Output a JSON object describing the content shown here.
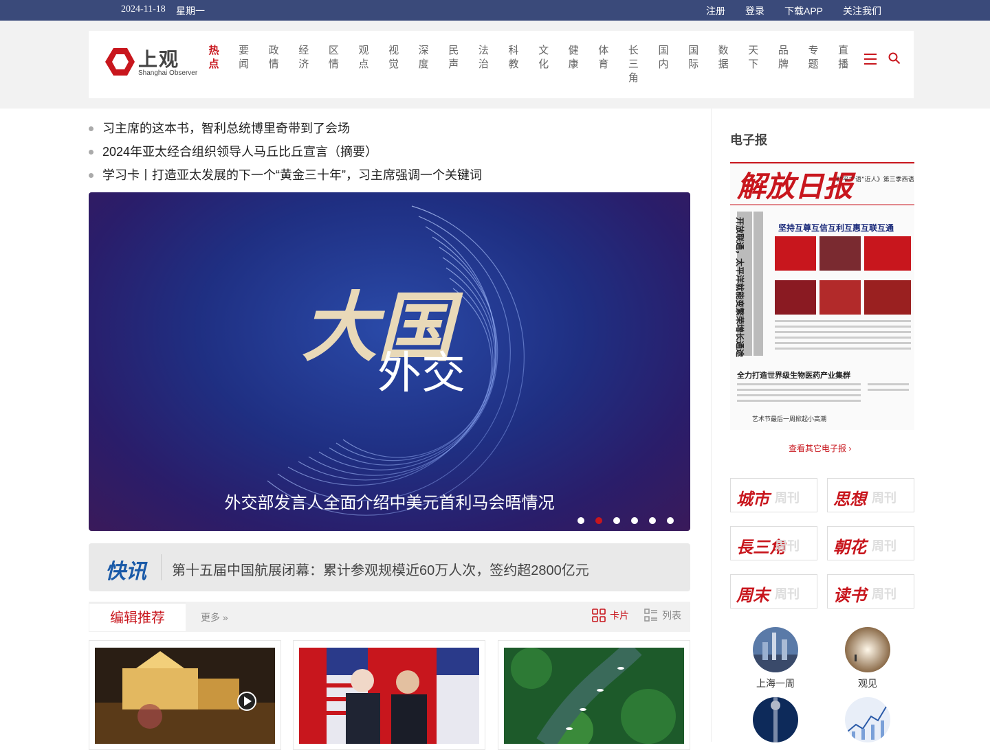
{
  "topbar": {
    "date": "2024-11-18",
    "weekday": "星期一",
    "links": [
      "注册",
      "登录",
      "下载APP",
      "关注我们"
    ]
  },
  "logo": {
    "cn": "上观",
    "en": "Shanghai Observer"
  },
  "nav": [
    "热点",
    "要闻",
    "政情",
    "经济",
    "区情",
    "观点",
    "视觉",
    "深度",
    "民声",
    "法治",
    "科教",
    "文化",
    "健康",
    "体育",
    "长三角",
    "国内",
    "国际",
    "数据",
    "天下",
    "品牌",
    "专题",
    "直播"
  ],
  "headlines": [
    "习主席的这本书，智利总统博里奇带到了会场",
    "2024年亚太经合组织领导人马丘比丘宣言（摘要）",
    "学习卡丨打造亚太发展的下一个“黄金三十年”，习主席强调一个关键词"
  ],
  "carousel": {
    "art_line1": "大国",
    "art_line2": "外交",
    "caption": "外交部发言人全面介绍中美元首利马会晤情况",
    "dots": 6,
    "active_dot": 2
  },
  "flash": {
    "label": "快讯",
    "text": "第十五届中国航展闭幕：累计参观规模近60万人次，签约超2800亿元"
  },
  "editor": {
    "tab": "编辑推荐",
    "more": "更多",
    "card": "卡片",
    "list": "列表"
  },
  "sidebar": {
    "title": "电子报",
    "paper_masthead": "解放日报",
    "paper_headlines": [
      "开放联通，太平洋就能变繁荣增长通途",
      "坚持互尊互信互利互惠互联互通",
      "全力打造世界级生物医药产业集群",
      "艺术节最后一周掀起小高潮",
      "《“平”“语”近人》第三季西语版启播"
    ],
    "other": "查看其它电子报",
    "weeklies": [
      "城市",
      "思想",
      "長三角",
      "朝花",
      "周末",
      "读书"
    ],
    "weekly_suffix": "周刊",
    "circles": [
      "上海一周",
      "观见"
    ]
  },
  "colors": {
    "accent": "#c8161d",
    "topbar": "#3a4a7a",
    "flash_label": "#1a5aa8"
  }
}
